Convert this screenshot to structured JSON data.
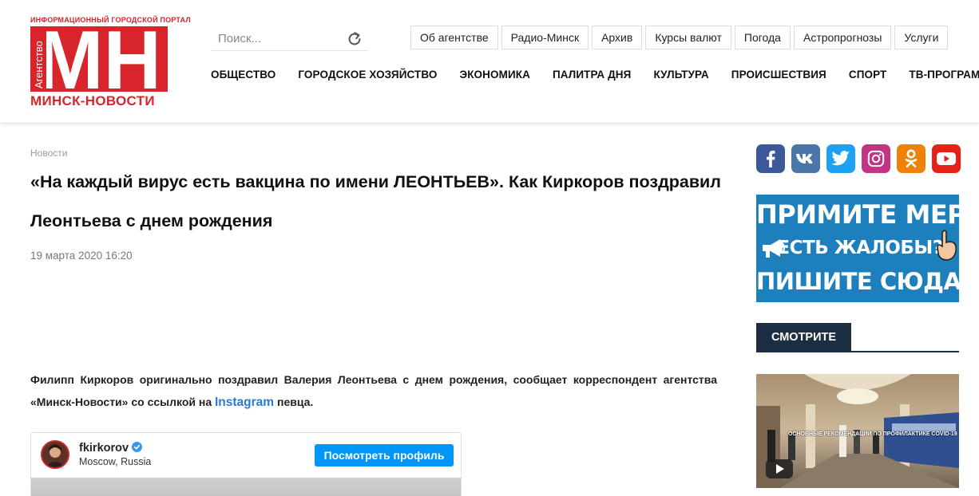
{
  "logo": {
    "top_text": "ИНФОРМАЦИОННЫЙ ГОРОДСКОЙ ПОРТАЛ",
    "side_text": "Агентство",
    "letters": "МН",
    "bottom_text": "МИНСК-НОВОСТИ"
  },
  "search": {
    "placeholder": "Поиск..."
  },
  "topnav": [
    "Об агентстве",
    "Радио-Минск",
    "Архив",
    "Курсы валют",
    "Погода",
    "Астропрогнозы",
    "Услуги"
  ],
  "mainnav": [
    "ОБЩЕСТВО",
    "ГОРОДСКОЕ ХОЗЯЙСТВО",
    "ЭКОНОМИКА",
    "ПАЛИТРА ДНЯ",
    "КУЛЬТУРА",
    "ПРОИСШЕСТВИЯ",
    "СПОРТ",
    "ТВ-ПРОГРАММА"
  ],
  "article": {
    "breadcrumb": "Новости",
    "title": "«На каждый вирус есть вакцина по имени ЛЕОНТЬЕВ». Как Киркоров поздравил Леонтьева с днем рождения",
    "date": "19 марта 2020 16:20",
    "lead_before": "Филипп Киркоров оригинально поздравил Валерия Леонтьева с днем рождения, сообщает корреспондент агентства «Минск-Новости» со ссылкой на ",
    "lead_link": "Instagram",
    "lead_after": " певца."
  },
  "instagram": {
    "username": "fkirkorov",
    "location": "Moscow, Russia",
    "button": "Посмотреть профиль"
  },
  "social": [
    {
      "icon": "facebook-icon",
      "color": "#3b5998"
    },
    {
      "icon": "vk-icon",
      "color": "#4a76a8"
    },
    {
      "icon": "twitter-icon",
      "color": "#1da1f2"
    },
    {
      "icon": "instagram-icon",
      "color": "#c13584"
    },
    {
      "icon": "odnoklassniki-icon",
      "color": "#ee8208"
    },
    {
      "icon": "youtube-icon",
      "color": "#e62117"
    }
  ],
  "banner": {
    "line1": "ПРИМИТЕ МЕРЫ!",
    "line2": "ЕСТЬ ЖАЛОБЫ?",
    "line3": "ПИШИТЕ СЮДА!"
  },
  "watch": {
    "tab": "СМОТРИТЕ"
  },
  "video": {
    "caption": "ОСНОВНЫЕ РЕКОМЕНДАЦИИ ПО ПРОФИЛАКТИКЕ COVID-19"
  },
  "colors": {
    "brand_red": "#d8242b",
    "link_blue": "#2a7bd1",
    "insta_blue": "#0095f6",
    "banner_blue": "#1d80bd",
    "tab_navy": "#1c2f42"
  }
}
